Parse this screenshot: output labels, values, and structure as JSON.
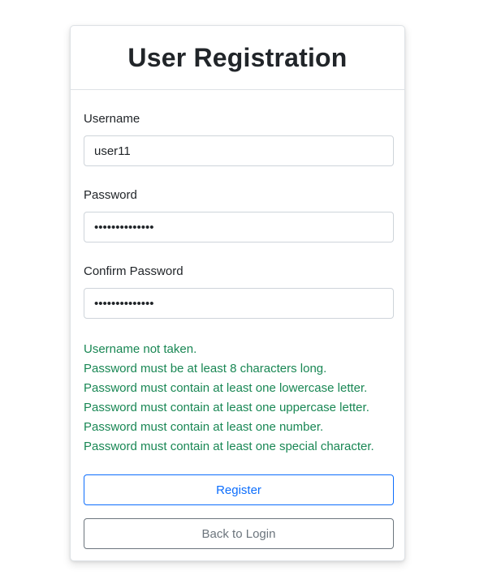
{
  "title": "User Registration",
  "fields": {
    "username": {
      "label": "Username",
      "value": "user11"
    },
    "password": {
      "label": "Password",
      "value": "••••••••••••••"
    },
    "confirm_password": {
      "label": "Confirm Password",
      "value": "••••••••••••••"
    }
  },
  "validation_messages": [
    "Username not taken.",
    "Password must be at least 8 characters long.",
    "Password must contain at least one lowercase letter.",
    "Password must contain at least one uppercase letter.",
    "Password must contain at least one number.",
    "Password must contain at least one special character."
  ],
  "buttons": {
    "register": "Register",
    "back_to_login": "Back to Login"
  },
  "colors": {
    "success": "#198754",
    "primary": "#0d6efd",
    "secondary": "#6c757d"
  }
}
